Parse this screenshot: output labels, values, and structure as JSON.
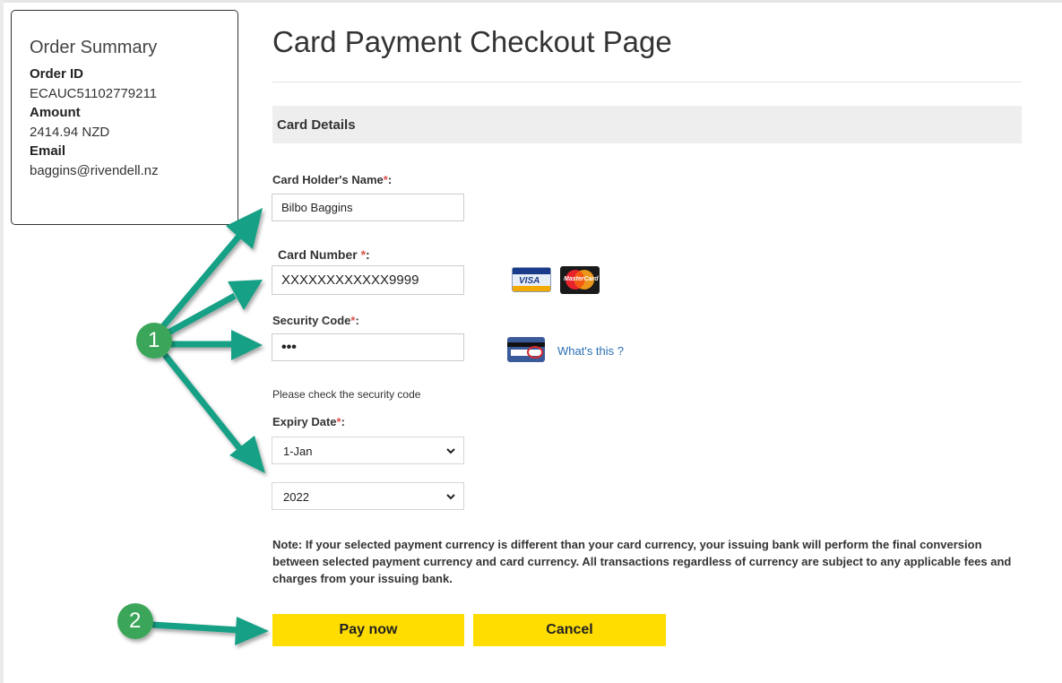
{
  "order_summary": {
    "title": "Order Summary",
    "order_id_label": "Order ID",
    "order_id": "ECAUC51102779211",
    "amount_label": "Amount",
    "amount": "2414.94 NZD",
    "email_label": "Email",
    "email": "baggins@rivendell.nz"
  },
  "page": {
    "title": "Card Payment Checkout Page",
    "section_title": "Card Details"
  },
  "form": {
    "required_mark": "*",
    "name_label": "Card Holder's Name",
    "name_value": "Bilbo Baggins",
    "card_number_label": "Card Number ",
    "card_number_value": "XXXXXXXXXXXX9999",
    "security_label": "Security Code",
    "security_value": "•••",
    "whats_this": "What's this ?",
    "security_hint": "Please check the security code",
    "expiry_label": "Expiry Date",
    "expiry_month": "1-Jan",
    "expiry_year": "2022",
    "colon": ":"
  },
  "card_logos": {
    "visa": "VISA",
    "mastercard": "MasterCard"
  },
  "note": "Note: If your selected payment currency is different than your card currency, your issuing bank will perform the final conversion between selected payment currency and card currency. All transactions regardless of currency are subject to any applicable fees and charges from your issuing bank.",
  "buttons": {
    "pay": "Pay now",
    "cancel": "Cancel"
  },
  "annotations": {
    "callout_1": "1",
    "callout_2": "2",
    "arrow_color": "#16a085",
    "circle_color": "#3ba65a"
  },
  "colors": {
    "button": "#ffdd00",
    "link": "#2a6fb4",
    "required": "#d9534f"
  }
}
